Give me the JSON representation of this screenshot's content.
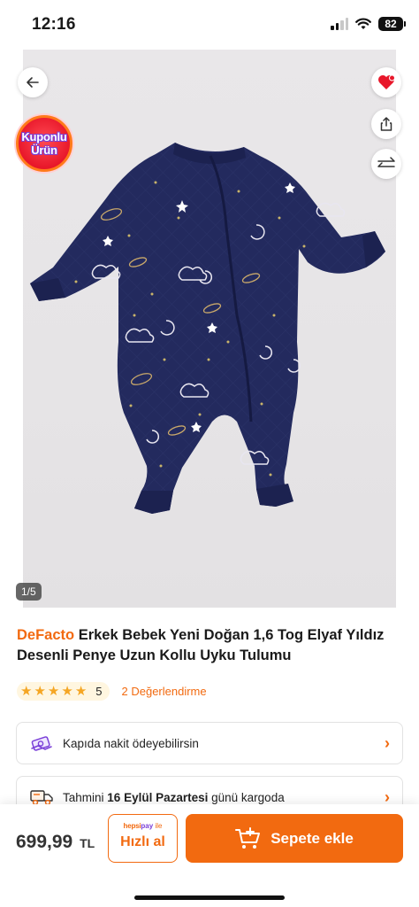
{
  "status_bar": {
    "time": "12:16",
    "battery": "82"
  },
  "gallery": {
    "badge_line1": "Kuponlu",
    "badge_line2": "Ürün",
    "page_indicator": "1/5",
    "icons": {
      "back": "arrow-left-icon",
      "favorite": "heart-icon",
      "share": "share-icon",
      "compare": "compare-arrows-icon"
    }
  },
  "product": {
    "brand": "DeFacto",
    "title": "Erkek Bebek Yeni Doğan 1,6 Tog Elyaf Yıldız Desenli Penye Uzun Kollu Uyku Tulumu",
    "rating": {
      "stars": 5,
      "score": "5",
      "reviews_label": "2 Değerlendirme"
    }
  },
  "info_cards": {
    "payment": {
      "text": "Kapıda nakit ödeyebilirsin",
      "icon": "cash-icon"
    },
    "shipping": {
      "prefix": "Tahmini",
      "date": "16 Eylül Pazartesi",
      "suffix": "günü kargoda",
      "icon": "delivery-truck-icon"
    }
  },
  "bottom_bar": {
    "price": "699,99",
    "currency": "TL",
    "quick_buy": {
      "brand_hepsi": "hepsi",
      "brand_pay": "pay",
      "brand_suffix": "ile",
      "label": "Hızlı al"
    },
    "add_to_cart": "Sepete ekle"
  },
  "colors": {
    "accent": "#f26a10",
    "product_navy": "#232a5e",
    "star": "#f5a623"
  }
}
